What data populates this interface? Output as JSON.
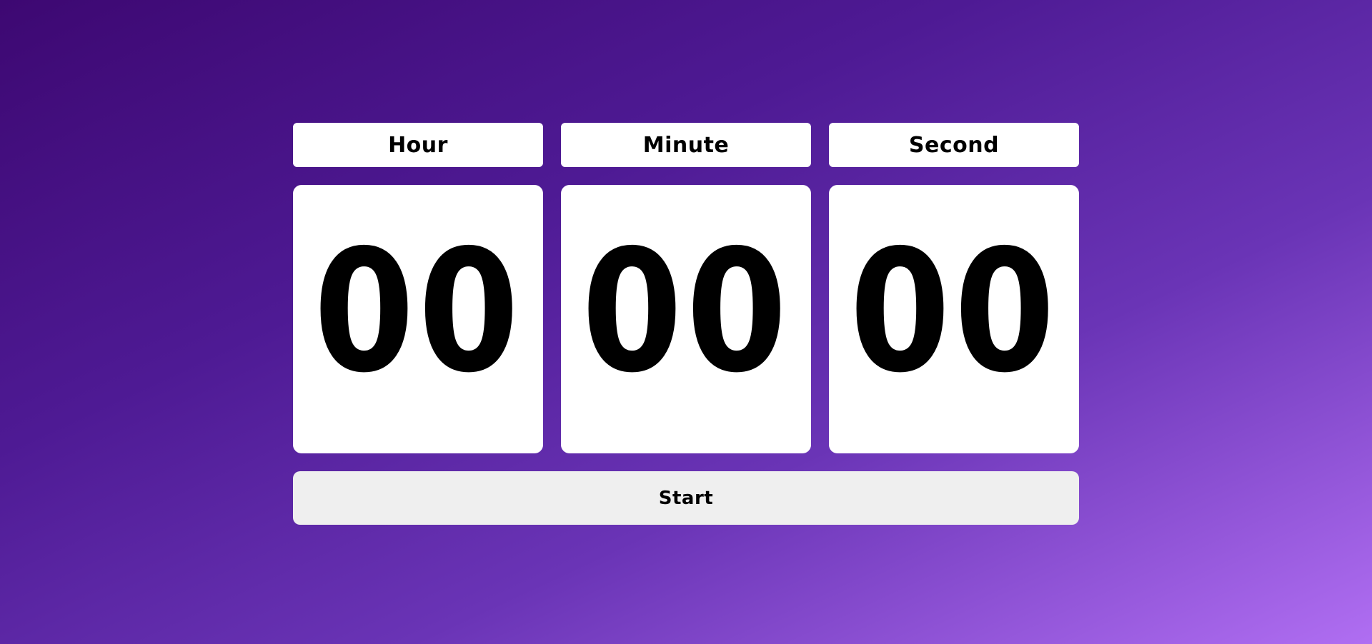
{
  "timer": {
    "labels": {
      "hour": "Hour",
      "minute": "Minute",
      "second": "Second"
    },
    "values": {
      "hour": "00",
      "minute": "00",
      "second": "00"
    },
    "start_label": "Start"
  },
  "theme": {
    "background_start": "#3d0872",
    "background_end": "#b06ef2",
    "card": "#ffffff",
    "button": "#efefef",
    "text": "#000000"
  }
}
